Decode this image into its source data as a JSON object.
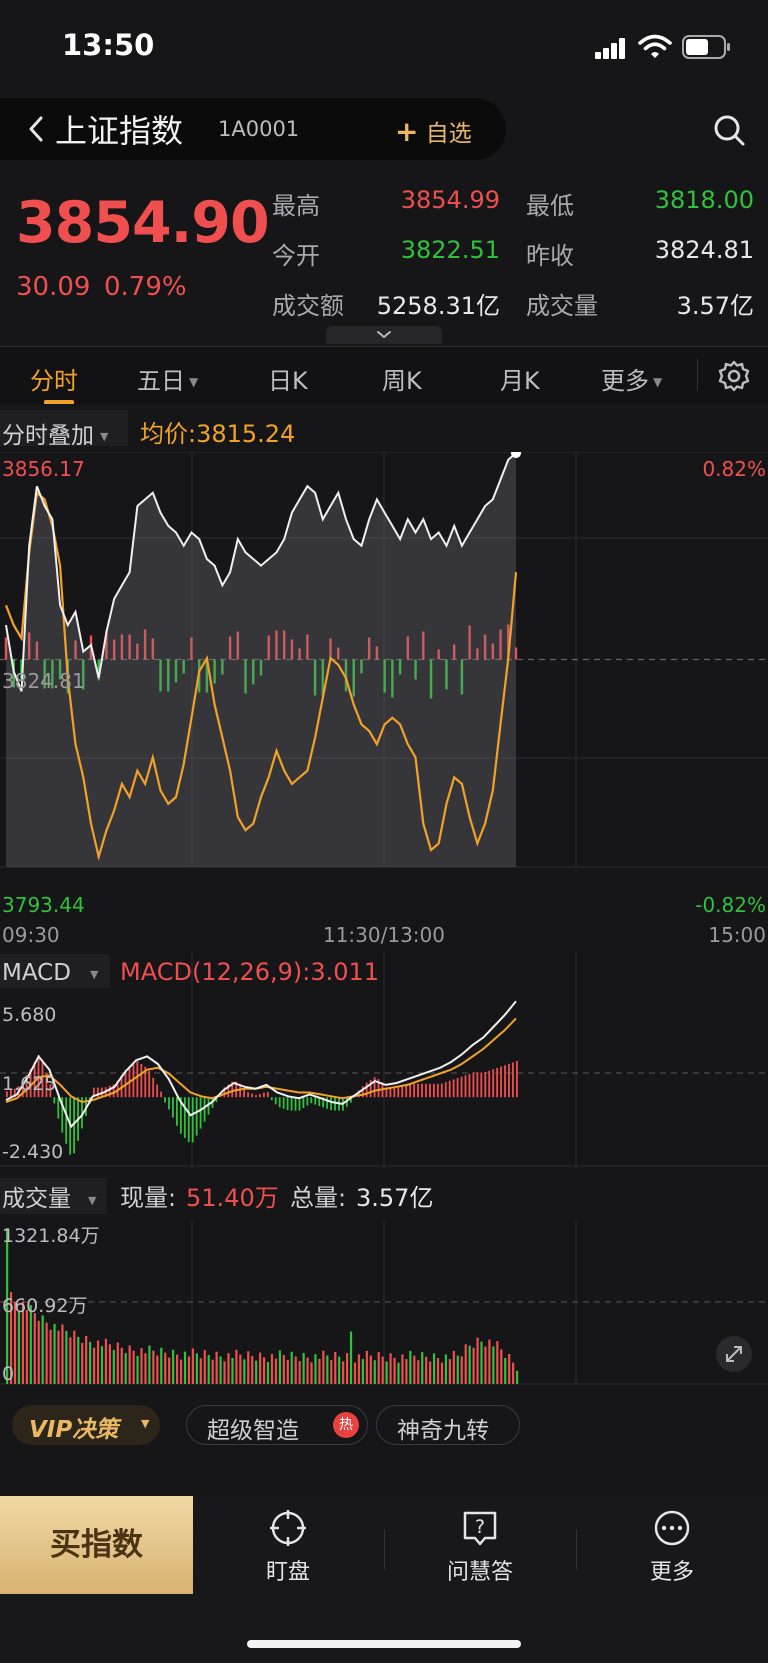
{
  "status_bar": {
    "time": "13:50"
  },
  "header": {
    "name": "上证指数",
    "code": "1A0001",
    "add_watchlist": "自选"
  },
  "quote": {
    "last": "3854.90",
    "change": "30.09",
    "change_pct": "0.79%",
    "high_label": "最高",
    "high": "3854.99",
    "low_label": "最低",
    "low": "3818.00",
    "open_label": "今开",
    "open": "3822.51",
    "prev_close_label": "昨收",
    "prev_close": "3824.81",
    "amount_label": "成交额",
    "amount": "5258.31亿",
    "volume_label": "成交量",
    "volume": "3.57亿"
  },
  "tabs": [
    {
      "label": "分时",
      "active": true
    },
    {
      "label": "五日"
    },
    {
      "label": "日K"
    },
    {
      "label": "周K"
    },
    {
      "label": "月K"
    },
    {
      "label": "更多"
    }
  ],
  "overlay": {
    "label": "分时叠加",
    "avg_label": "均价:3815.24"
  },
  "colors": {
    "up": "#f04f4f",
    "down": "#2fc23c",
    "accent": "#f2a227",
    "gold": "#e9b766"
  },
  "chart_data": [
    {
      "type": "line",
      "x_ticks": [
        "09:30",
        "11:30/13:00",
        "15:00"
      ],
      "y_labels": {
        "top": "3856.17",
        "mid": "3824.81",
        "bottom": "3793.44"
      },
      "pct_labels": {
        "top": "0.82%",
        "bottom": "-0.82%"
      },
      "ylim": [
        3793.44,
        3856.17
      ],
      "prev_close": 3824.81,
      "series": [
        {
          "values": [
            3830,
            3823,
            3820,
            3842,
            3851,
            3848,
            3846,
            3833,
            3830,
            3832,
            3826,
            3827,
            3822,
            3829,
            3834,
            3836,
            3838,
            3848,
            3849,
            3850,
            3847,
            3845,
            3844,
            3842,
            3844,
            3843,
            3840,
            3839,
            3836,
            3838,
            3843,
            3841,
            3840,
            3839,
            3840,
            3841,
            3843,
            3847,
            3849,
            3851,
            3850,
            3846,
            3848,
            3850,
            3846,
            3843,
            3842,
            3846,
            3849,
            3847,
            3845,
            3843,
            3846,
            3844,
            3846,
            3843,
            3844,
            3842,
            3845,
            3842,
            3844,
            3846,
            3848,
            3849,
            3852,
            3855,
            3856
          ],
          "index_range": [
            0,
            240
          ]
        },
        {
          "values": [
            3833,
            3830,
            3828,
            3841,
            3850,
            3849,
            3845,
            3839,
            3822,
            3812,
            3807,
            3800,
            3795,
            3799,
            3802,
            3806,
            3804,
            3808,
            3806,
            3810,
            3805,
            3803,
            3804,
            3809,
            3816,
            3823,
            3825,
            3818,
            3813,
            3808,
            3801,
            3799,
            3800,
            3804,
            3807,
            3811,
            3808,
            3806,
            3807,
            3808,
            3813,
            3819,
            3825,
            3824,
            3822,
            3818,
            3815,
            3814,
            3812,
            3815,
            3816,
            3815,
            3812,
            3810,
            3800,
            3796,
            3797,
            3803,
            3807,
            3806,
            3801,
            3797,
            3800,
            3805,
            3815,
            3825,
            3838
          ],
          "index_range": [
            0,
            240
          ]
        }
      ],
      "volume_bars_overlay": "red/green bars at prev_close line"
    },
    {
      "type": "line",
      "title": "MACD",
      "params": "MACD(12,26,9):3.011",
      "y_labels": {
        "top": "5.680",
        "mid": "1.625",
        "bottom": "-2.430"
      },
      "ylim": [
        -2.43,
        5.68
      ],
      "series": [
        {
          "values": [
            0.2,
            0.5,
            1.4,
            2.5,
            1.8,
            0.2,
            -1.2,
            -0.6,
            0.4,
            0.6,
            0.9,
            1.7,
            2.3,
            2.5,
            2.1,
            1.3,
            0.2,
            -0.6,
            -0.3,
            0.1,
            0.7,
            1.1,
            0.9,
            0.8,
            1.0,
            0.6,
            0.4,
            0.3,
            0.5,
            0.3,
            0.1,
            0.0,
            0.4,
            0.8,
            1.2,
            1.0,
            1.1,
            1.3,
            1.5,
            1.7,
            1.9,
            2.2,
            2.6,
            3.1,
            3.5,
            4.1,
            4.7,
            5.4
          ]
        },
        {
          "values": [
            0.1,
            0.3,
            0.8,
            1.4,
            1.5,
            1.0,
            0.4,
            0.1,
            0.2,
            0.4,
            0.6,
            1.0,
            1.4,
            1.8,
            1.9,
            1.6,
            1.1,
            0.6,
            0.4,
            0.3,
            0.5,
            0.7,
            0.8,
            0.8,
            0.9,
            0.8,
            0.7,
            0.6,
            0.6,
            0.5,
            0.4,
            0.3,
            0.4,
            0.5,
            0.7,
            0.8,
            0.9,
            1.0,
            1.2,
            1.4,
            1.6,
            1.8,
            2.1,
            2.5,
            2.9,
            3.4,
            3.9,
            4.5
          ]
        }
      ]
    },
    {
      "type": "bar",
      "title": "成交量",
      "current_label": "现量:",
      "current_value": "51.40万",
      "total_label": "总量:",
      "total_value": "3.57亿",
      "y_labels": {
        "top": "1321.84万",
        "mid": "660.92万",
        "bottom": "0"
      },
      "ylim": [
        0,
        1321.84
      ]
    }
  ],
  "chips": {
    "vip": "VIP决策",
    "super": "超级智造",
    "hot": "热",
    "magic": "神奇九转"
  },
  "bottom_nav": {
    "buy": "买指数",
    "watch": "盯盘",
    "ask": "问慧答",
    "more": "更多"
  }
}
